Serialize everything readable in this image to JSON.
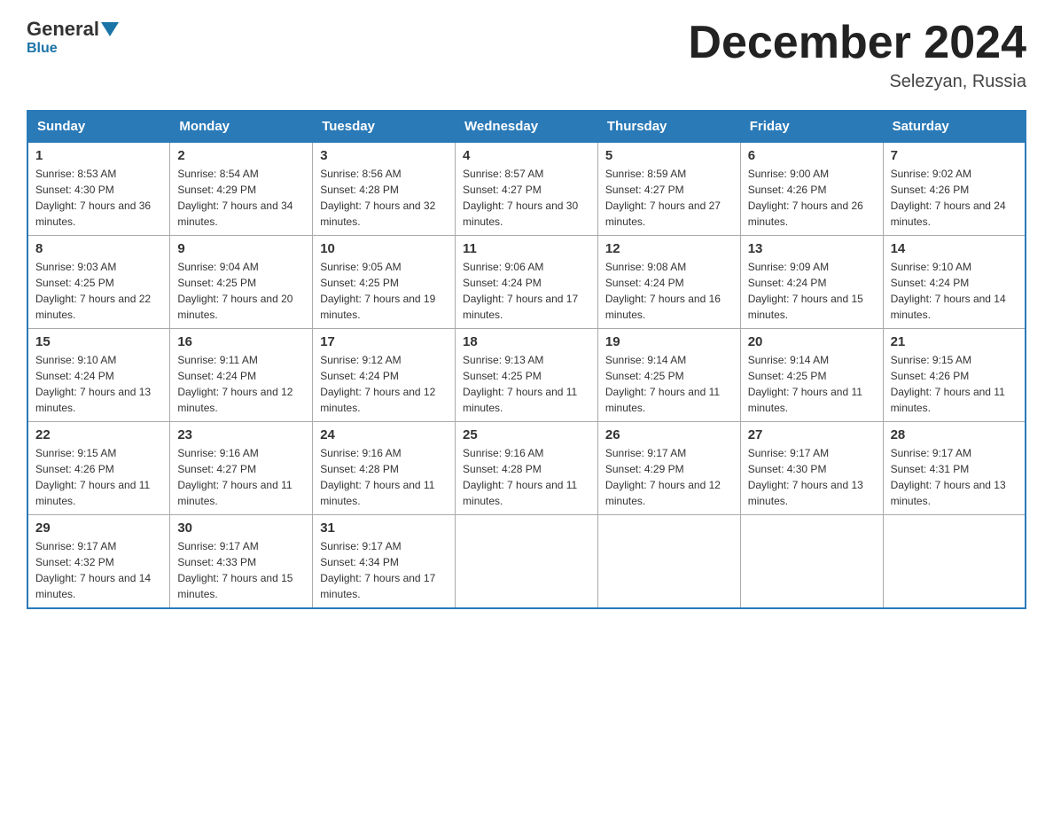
{
  "header": {
    "logo": {
      "general": "General",
      "blue": "Blue"
    },
    "title": "December 2024",
    "location": "Selezyan, Russia"
  },
  "calendar": {
    "days_of_week": [
      "Sunday",
      "Monday",
      "Tuesday",
      "Wednesday",
      "Thursday",
      "Friday",
      "Saturday"
    ],
    "weeks": [
      [
        {
          "day": "1",
          "sunrise": "8:53 AM",
          "sunset": "4:30 PM",
          "daylight": "7 hours and 36 minutes."
        },
        {
          "day": "2",
          "sunrise": "8:54 AM",
          "sunset": "4:29 PM",
          "daylight": "7 hours and 34 minutes."
        },
        {
          "day": "3",
          "sunrise": "8:56 AM",
          "sunset": "4:28 PM",
          "daylight": "7 hours and 32 minutes."
        },
        {
          "day": "4",
          "sunrise": "8:57 AM",
          "sunset": "4:27 PM",
          "daylight": "7 hours and 30 minutes."
        },
        {
          "day": "5",
          "sunrise": "8:59 AM",
          "sunset": "4:27 PM",
          "daylight": "7 hours and 27 minutes."
        },
        {
          "day": "6",
          "sunrise": "9:00 AM",
          "sunset": "4:26 PM",
          "daylight": "7 hours and 26 minutes."
        },
        {
          "day": "7",
          "sunrise": "9:02 AM",
          "sunset": "4:26 PM",
          "daylight": "7 hours and 24 minutes."
        }
      ],
      [
        {
          "day": "8",
          "sunrise": "9:03 AM",
          "sunset": "4:25 PM",
          "daylight": "7 hours and 22 minutes."
        },
        {
          "day": "9",
          "sunrise": "9:04 AM",
          "sunset": "4:25 PM",
          "daylight": "7 hours and 20 minutes."
        },
        {
          "day": "10",
          "sunrise": "9:05 AM",
          "sunset": "4:25 PM",
          "daylight": "7 hours and 19 minutes."
        },
        {
          "day": "11",
          "sunrise": "9:06 AM",
          "sunset": "4:24 PM",
          "daylight": "7 hours and 17 minutes."
        },
        {
          "day": "12",
          "sunrise": "9:08 AM",
          "sunset": "4:24 PM",
          "daylight": "7 hours and 16 minutes."
        },
        {
          "day": "13",
          "sunrise": "9:09 AM",
          "sunset": "4:24 PM",
          "daylight": "7 hours and 15 minutes."
        },
        {
          "day": "14",
          "sunrise": "9:10 AM",
          "sunset": "4:24 PM",
          "daylight": "7 hours and 14 minutes."
        }
      ],
      [
        {
          "day": "15",
          "sunrise": "9:10 AM",
          "sunset": "4:24 PM",
          "daylight": "7 hours and 13 minutes."
        },
        {
          "day": "16",
          "sunrise": "9:11 AM",
          "sunset": "4:24 PM",
          "daylight": "7 hours and 12 minutes."
        },
        {
          "day": "17",
          "sunrise": "9:12 AM",
          "sunset": "4:24 PM",
          "daylight": "7 hours and 12 minutes."
        },
        {
          "day": "18",
          "sunrise": "9:13 AM",
          "sunset": "4:25 PM",
          "daylight": "7 hours and 11 minutes."
        },
        {
          "day": "19",
          "sunrise": "9:14 AM",
          "sunset": "4:25 PM",
          "daylight": "7 hours and 11 minutes."
        },
        {
          "day": "20",
          "sunrise": "9:14 AM",
          "sunset": "4:25 PM",
          "daylight": "7 hours and 11 minutes."
        },
        {
          "day": "21",
          "sunrise": "9:15 AM",
          "sunset": "4:26 PM",
          "daylight": "7 hours and 11 minutes."
        }
      ],
      [
        {
          "day": "22",
          "sunrise": "9:15 AM",
          "sunset": "4:26 PM",
          "daylight": "7 hours and 11 minutes."
        },
        {
          "day": "23",
          "sunrise": "9:16 AM",
          "sunset": "4:27 PM",
          "daylight": "7 hours and 11 minutes."
        },
        {
          "day": "24",
          "sunrise": "9:16 AM",
          "sunset": "4:28 PM",
          "daylight": "7 hours and 11 minutes."
        },
        {
          "day": "25",
          "sunrise": "9:16 AM",
          "sunset": "4:28 PM",
          "daylight": "7 hours and 11 minutes."
        },
        {
          "day": "26",
          "sunrise": "9:17 AM",
          "sunset": "4:29 PM",
          "daylight": "7 hours and 12 minutes."
        },
        {
          "day": "27",
          "sunrise": "9:17 AM",
          "sunset": "4:30 PM",
          "daylight": "7 hours and 13 minutes."
        },
        {
          "day": "28",
          "sunrise": "9:17 AM",
          "sunset": "4:31 PM",
          "daylight": "7 hours and 13 minutes."
        }
      ],
      [
        {
          "day": "29",
          "sunrise": "9:17 AM",
          "sunset": "4:32 PM",
          "daylight": "7 hours and 14 minutes."
        },
        {
          "day": "30",
          "sunrise": "9:17 AM",
          "sunset": "4:33 PM",
          "daylight": "7 hours and 15 minutes."
        },
        {
          "day": "31",
          "sunrise": "9:17 AM",
          "sunset": "4:34 PM",
          "daylight": "7 hours and 17 minutes."
        },
        null,
        null,
        null,
        null
      ]
    ]
  }
}
